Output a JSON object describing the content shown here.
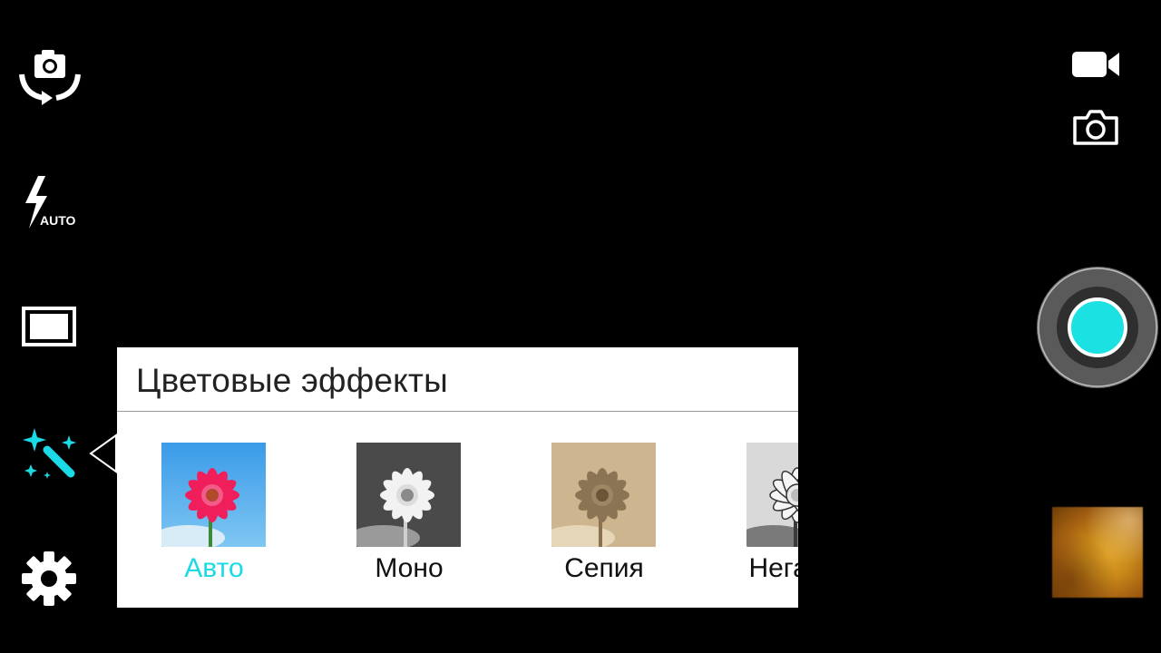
{
  "camera": {
    "left_rail": [
      {
        "name": "switch-camera",
        "icon": "camera-switch-icon"
      },
      {
        "name": "flash-mode",
        "icon": "flash-icon",
        "badge": "AUTO"
      },
      {
        "name": "aspect-ratio",
        "icon": "aspect-ratio-icon"
      },
      {
        "name": "color-effects",
        "icon": "magic-wand-icon",
        "active": true
      },
      {
        "name": "settings",
        "icon": "gear-icon"
      }
    ],
    "right_rail": [
      {
        "name": "video-mode",
        "icon": "video-camera-icon"
      },
      {
        "name": "photo-mode",
        "icon": "camera-icon"
      },
      {
        "name": "shutter",
        "icon": "shutter-icon"
      },
      {
        "name": "gallery-thumbnail",
        "icon": "gallery-icon"
      }
    ],
    "accent_color": "#1cd9e6"
  },
  "effects_panel": {
    "title": "Цветовые эффекты",
    "items": [
      {
        "label": "Авто",
        "selected": true
      },
      {
        "label": "Моно",
        "selected": false
      },
      {
        "label": "Сепия",
        "selected": false
      },
      {
        "label": "Негатив",
        "selected": false
      }
    ]
  }
}
